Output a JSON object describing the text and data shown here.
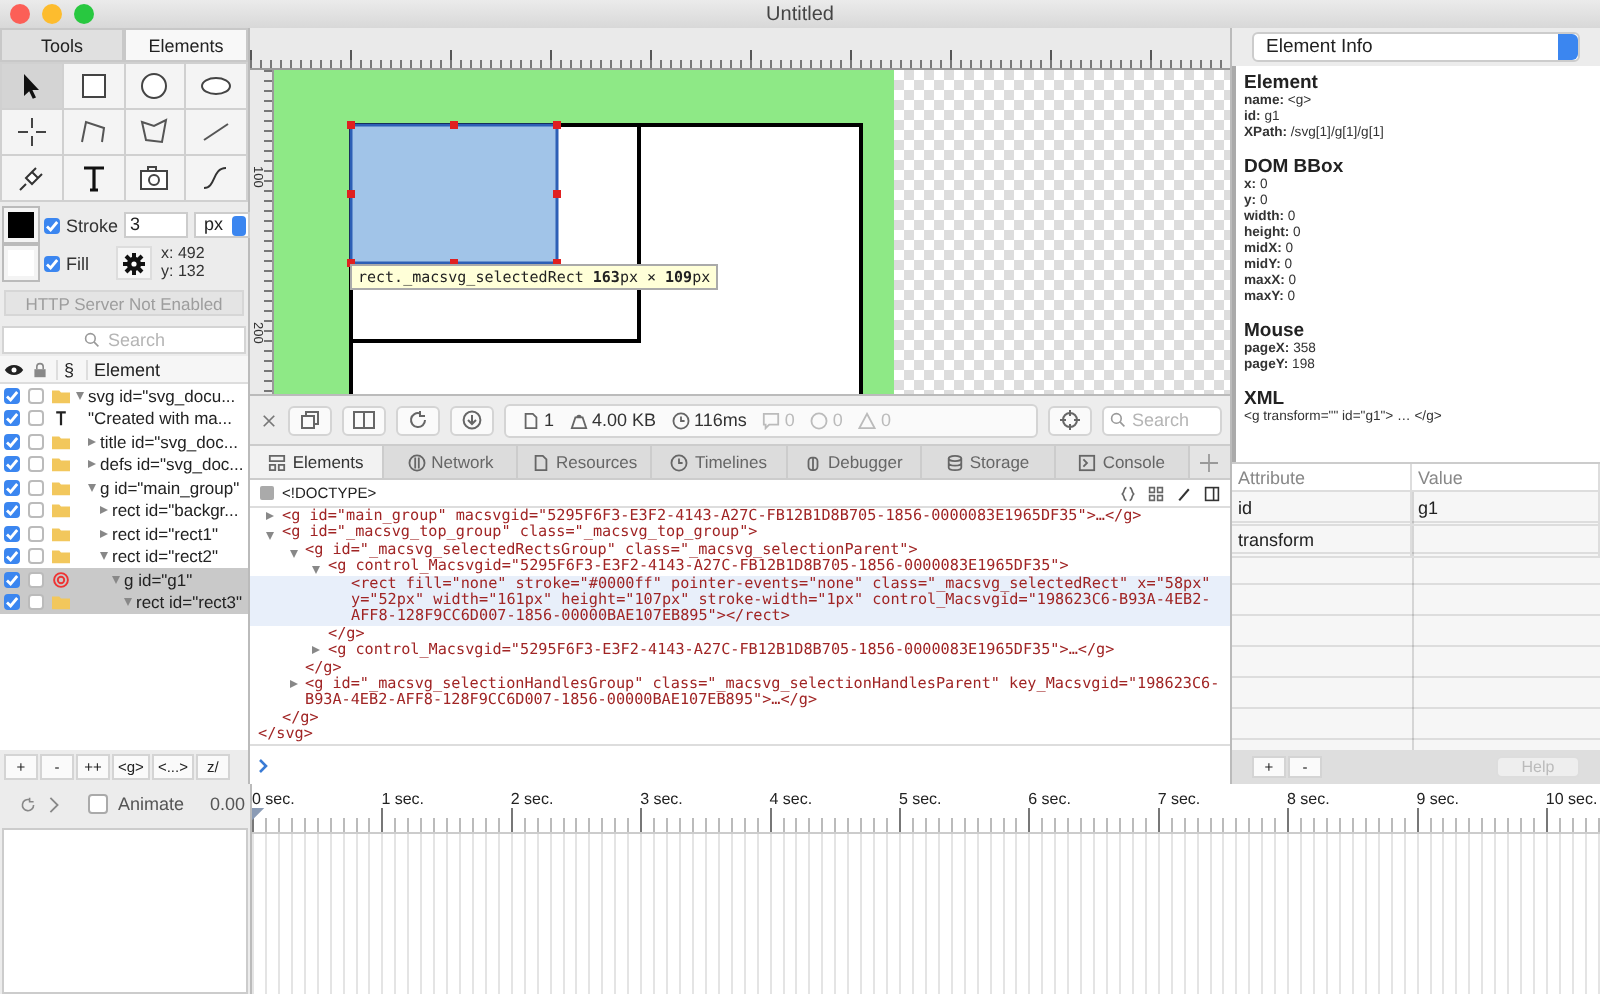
{
  "window": {
    "title": "Untitled"
  },
  "left_panel": {
    "tabs": [
      {
        "label": "Tools",
        "selected": false
      },
      {
        "label": "Elements",
        "selected": true
      }
    ],
    "tools": [
      {
        "kind": "arrow",
        "selected": true
      },
      {
        "kind": "rect",
        "selected": false
      },
      {
        "kind": "circle",
        "selected": false
      },
      {
        "kind": "ellipse",
        "selected": false
      },
      {
        "kind": "crosshair",
        "selected": false
      },
      {
        "kind": "polyline",
        "selected": false
      },
      {
        "kind": "polygon",
        "selected": false
      },
      {
        "kind": "line",
        "selected": false
      },
      {
        "kind": "plug",
        "selected": false
      },
      {
        "kind": "text",
        "selected": false
      },
      {
        "kind": "image",
        "selected": false
      },
      {
        "kind": "path",
        "selected": false
      }
    ],
    "stroke": {
      "label": "Stroke",
      "checked": true,
      "value": "3",
      "unit": "px"
    },
    "fill": {
      "label": "Fill",
      "checked": true
    },
    "coords": [
      "x: 492",
      "y: 132"
    ],
    "http_button": {
      "label": "HTTP Server Not Enabled",
      "disabled": true
    },
    "search": {
      "placeholder": "Search"
    },
    "tree_columns": [
      "§",
      "Element"
    ],
    "tree": [
      {
        "kind": "folder",
        "label": "svg id=\"svg_docu...",
        "visible": true,
        "locked": false,
        "expanded": true,
        "selected": false,
        "children": [
          {
            "kind": "text",
            "label": "\"Created with ma...",
            "visible": true,
            "locked": false,
            "selected": false
          },
          {
            "kind": "folder",
            "label": "title id=\"svg_doc...",
            "visible": true,
            "locked": false,
            "expanded": false,
            "selected": false
          },
          {
            "kind": "folder",
            "label": "defs id=\"svg_doc...",
            "visible": true,
            "locked": false,
            "expanded": false,
            "selected": false
          },
          {
            "kind": "folder",
            "label": "g id=\"main_group\"",
            "visible": true,
            "locked": false,
            "expanded": true,
            "selected": false,
            "children": [
              {
                "kind": "folder",
                "label": "rect id=\"backgr...",
                "visible": true,
                "locked": false,
                "expanded": false,
                "selected": false
              },
              {
                "kind": "folder",
                "label": "rect id=\"rect1\"",
                "visible": true,
                "locked": false,
                "expanded": false,
                "selected": false
              },
              {
                "kind": "folder",
                "label": "rect id=\"rect2\"",
                "visible": true,
                "locked": false,
                "expanded": true,
                "selected": false,
                "children": [
                  {
                    "kind": "target",
                    "label": "g id=\"g1\"",
                    "visible": true,
                    "locked": false,
                    "expanded": true,
                    "selected": true,
                    "children": [
                      {
                        "kind": "folder",
                        "label": "rect id=\"rect3\"",
                        "visible": true,
                        "locked": false,
                        "expanded": true,
                        "selected": true
                      }
                    ]
                  }
                ]
              }
            ]
          }
        ]
      }
    ],
    "buttons": [
      "+",
      "-",
      "++",
      "<g>",
      "<...>",
      "z/"
    ]
  },
  "canvas": {
    "vertical_ruler_labels": [
      "100",
      "200"
    ],
    "tooltip": "rect._macsvg_selectedRect **163**px × **109**px"
  },
  "devtools": {
    "stats": [
      {
        "kind": "resources",
        "text": "1",
        "disabled": false
      },
      {
        "kind": "size",
        "text": "4.00 KB",
        "disabled": false
      },
      {
        "kind": "time",
        "text": "116ms",
        "disabled": false
      },
      {
        "kind": "logs",
        "text": "0",
        "disabled": true
      },
      {
        "kind": "errors",
        "text": "0",
        "disabled": true
      },
      {
        "kind": "warnings",
        "text": "0",
        "disabled": true
      }
    ],
    "search": {
      "placeholder": "Search"
    },
    "tabs": [
      {
        "kind": "elements",
        "label": "Elements",
        "selected": true
      },
      {
        "kind": "network",
        "label": "Network",
        "selected": false
      },
      {
        "kind": "resources",
        "label": "Resources",
        "selected": false
      },
      {
        "kind": "timelines",
        "label": "Timelines",
        "selected": false
      },
      {
        "kind": "debugger",
        "label": "Debugger",
        "selected": false
      },
      {
        "kind": "storage",
        "label": "Storage",
        "selected": false
      },
      {
        "kind": "console",
        "label": "Console",
        "selected": false
      }
    ],
    "breadcrumb": "<!DOCTYPE>",
    "nodes": [
      {
        "open": "<g id=\"main_group\" macsvgid=\"5295F6F3-E3F2-4143-A27C-FB12B1D8B705-1856-0000083E1965DF35\">…</g>",
        "expanded": false,
        "selected": false
      },
      {
        "open": "<g id=\"_macsvg_top_group\" class=\"_macsvg_top_group\">",
        "close": "</g>",
        "expanded": true,
        "selected": false,
        "children": [
          {
            "open": "<g id=\"_macsvg_selectedRectsGroup\" class=\"_macsvg_selectionParent\">",
            "close": "</g>",
            "expanded": true,
            "selected": false,
            "children": [
              {
                "open": "<g control_Macsvgid=\"5295F6F3-E3F2-4143-A27C-FB12B1D8B705-1856-0000083E1965DF35\">",
                "close": "</g>",
                "expanded": true,
                "selected": false,
                "children": [
                  {
                    "open": "<rect fill=\"none\" stroke=\"#0000ff\" pointer-events=\"none\" class=\"_macsvg_selectedRect\" x=\"58px\" y=\"52px\" width=\"161px\" height=\"107px\" stroke-width=\"1px\" control_Macsvgid=\"198623C6-B93A-4EB2-AFF8-128F9CC6D007-1856-00000BAE107EB895\"></rect>",
                    "selected": true
                  }
                ]
              },
              {
                "open": "<g control_Macsvgid=\"5295F6F3-E3F2-4143-A27C-FB12B1D8B705-1856-0000083E1965DF35\">…</g>",
                "expanded": false,
                "selected": false
              }
            ]
          },
          {
            "open": "<g id=\"_macsvg_selectionHandlesGroup\" class=\"_macsvg_selectionHandlesParent\" key_Macsvgid=\"198623C6-B93A-4EB2-AFF8-128F9CC6D007-1856-00000BAE107EB895\">…</g>",
            "expanded": false,
            "selected": false
          }
        ]
      }
    ],
    "closing": "</svg>"
  },
  "right_panel": {
    "dropdown": "Element Info",
    "sections": [
      {
        "title": "Element",
        "fields": [
          {
            "label": "name:",
            "value": "<g>"
          },
          {
            "label": "id:",
            "value": "g1"
          },
          {
            "label": "XPath:",
            "value": "/svg[1]/g[1]/g[1]"
          }
        ]
      },
      {
        "title": "DOM BBox",
        "fields": [
          {
            "label": "x:",
            "value": "0"
          },
          {
            "label": "y:",
            "value": "0"
          },
          {
            "label": "width:",
            "value": "0"
          },
          {
            "label": "height:",
            "value": "0"
          },
          {
            "label": "midX:",
            "value": "0"
          },
          {
            "label": "midY:",
            "value": "0"
          },
          {
            "label": "maxX:",
            "value": "0"
          },
          {
            "label": "maxY:",
            "value": "0"
          }
        ]
      },
      {
        "title": "Mouse",
        "fields": [
          {
            "label": "pageX:",
            "value": "358"
          },
          {
            "label": "pageY:",
            "value": "198"
          }
        ]
      },
      {
        "title": "XML",
        "text": "<g transform=\"\" id=\"g1\"> … </g>"
      }
    ],
    "table": {
      "columns": [
        "Attribute",
        "Value"
      ],
      "rows": [
        {
          "name": "id",
          "value": "g1"
        },
        {
          "name": "transform"
        }
      ]
    },
    "buttons": [
      "+",
      "-"
    ],
    "help": {
      "label": "Help",
      "disabled": true
    }
  },
  "timeline": {
    "animate": {
      "label": "Animate",
      "checked": false
    },
    "time": "0.00",
    "labels": [
      "0 sec.",
      "1 sec.",
      "2 sec.",
      "3 sec.",
      "4 sec.",
      "5 sec.",
      "6 sec.",
      "7 sec.",
      "8 sec.",
      "9 sec.",
      "10 sec."
    ]
  }
}
